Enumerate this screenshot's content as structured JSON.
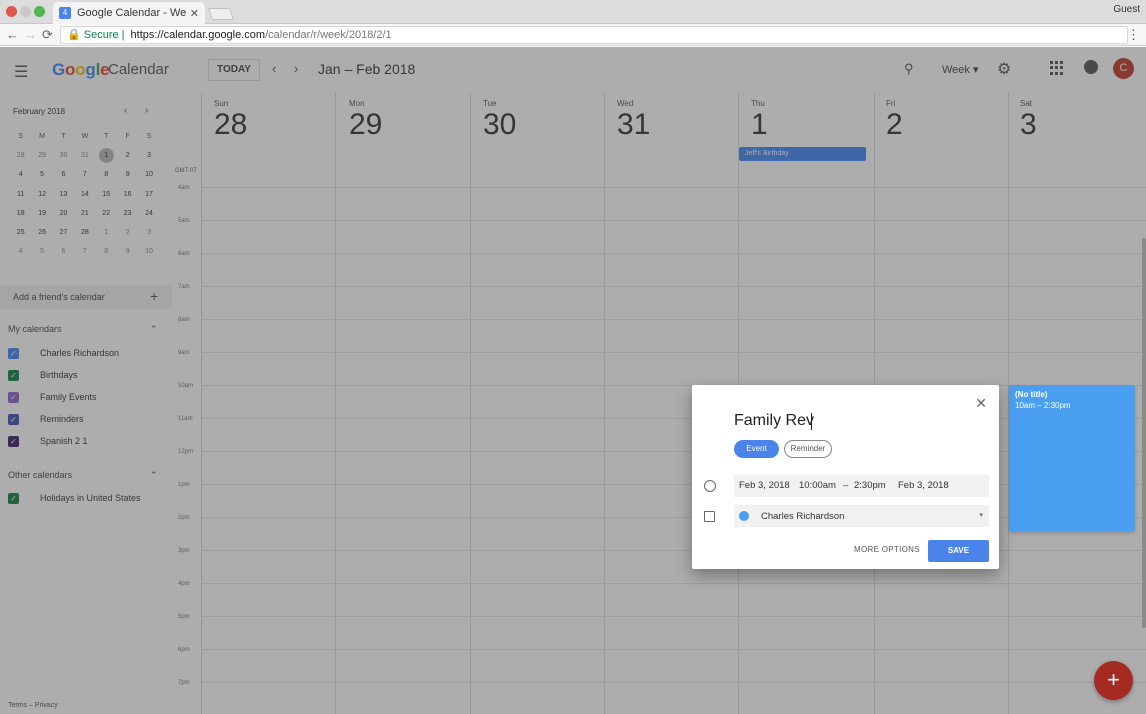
{
  "browser": {
    "tab_title": "Google Calendar - Week of Jan",
    "tab_close": "✕",
    "guest_label": "Guest",
    "secure_label": "Secure",
    "url_host": "https://calendar.google.com",
    "url_path": "/calendar/r/week/2018/2/1",
    "back": "←",
    "forward": "→",
    "reload": "⟳",
    "menu": "⋮"
  },
  "header": {
    "menu_icon": "☰",
    "logo_letters": [
      "G",
      "o",
      "o",
      "g",
      "l",
      "e"
    ],
    "logo_calendar": "Calendar",
    "today_label": "TODAY",
    "prev": "‹",
    "next": "›",
    "range_title": "Jan – Feb 2018",
    "search_icon": "⚲",
    "view_label": "Week ▾",
    "gear": "⚙",
    "avatar_letter": "C"
  },
  "mini_calendar": {
    "title": "February 2018",
    "prev": "‹",
    "next": "›",
    "dow": [
      "S",
      "M",
      "T",
      "W",
      "T",
      "F",
      "S"
    ],
    "weeks": [
      [
        "28",
        "29",
        "30",
        "31",
        "1",
        "2",
        "3"
      ],
      [
        "4",
        "5",
        "6",
        "7",
        "8",
        "9",
        "10"
      ],
      [
        "11",
        "12",
        "13",
        "14",
        "15",
        "16",
        "17"
      ],
      [
        "18",
        "19",
        "20",
        "21",
        "22",
        "23",
        "24"
      ],
      [
        "25",
        "26",
        "27",
        "28",
        "1",
        "2",
        "3"
      ],
      [
        "4",
        "5",
        "6",
        "7",
        "8",
        "9",
        "10"
      ]
    ]
  },
  "sidebar": {
    "add_friend": "Add a friend's calendar",
    "add_plus": "+",
    "my_calendars": "My calendars",
    "other_calendars": "Other calendars",
    "chevron": "⌃",
    "my_items": [
      {
        "label": "Charles Richardson",
        "color": "#4285f4"
      },
      {
        "label": "Birthdays",
        "color": "#0b8043"
      },
      {
        "label": "Family Events",
        "color": "#8e63ce"
      },
      {
        "label": "Reminders",
        "color": "#3f51b5"
      },
      {
        "label": "Spanish 2 1",
        "color": "#3b1c6a"
      }
    ],
    "other_items": [
      {
        "label": "Holidays in United States",
        "color": "#0b8043"
      }
    ],
    "footer": "Terms – Privacy"
  },
  "week": {
    "days": [
      {
        "dow": "Sun",
        "num": "28"
      },
      {
        "dow": "Mon",
        "num": "29"
      },
      {
        "dow": "Tue",
        "num": "30"
      },
      {
        "dow": "Wed",
        "num": "31"
      },
      {
        "dow": "Thu",
        "num": "1"
      },
      {
        "dow": "Fri",
        "num": "2"
      },
      {
        "dow": "Sat",
        "num": "3"
      }
    ],
    "timezone": "GMT-07",
    "hours": [
      "4am",
      "5am",
      "6am",
      "7am",
      "8am",
      "9am",
      "10am",
      "11am",
      "12pm",
      "1pm",
      "2pm",
      "3pm",
      "4pm",
      "5pm",
      "6pm",
      "7pm"
    ],
    "allday_event": "Jeff's Birthday",
    "draft_event": {
      "title": "(No title)",
      "time": "10am – 2:30pm"
    }
  },
  "dialog": {
    "close": "✕",
    "title_value": "Family Rev",
    "event_label": "Event",
    "reminder_label": "Reminder",
    "start_date": "Feb 3, 2018",
    "start_time": "10:00am",
    "dash": "–",
    "end_time": "2:30pm",
    "end_date": "Feb 3, 2018",
    "calendar_name": "Charles Richardson",
    "dropdown": "▾",
    "more_options": "MORE OPTIONS",
    "save": "SAVE"
  },
  "fab_label": "+"
}
